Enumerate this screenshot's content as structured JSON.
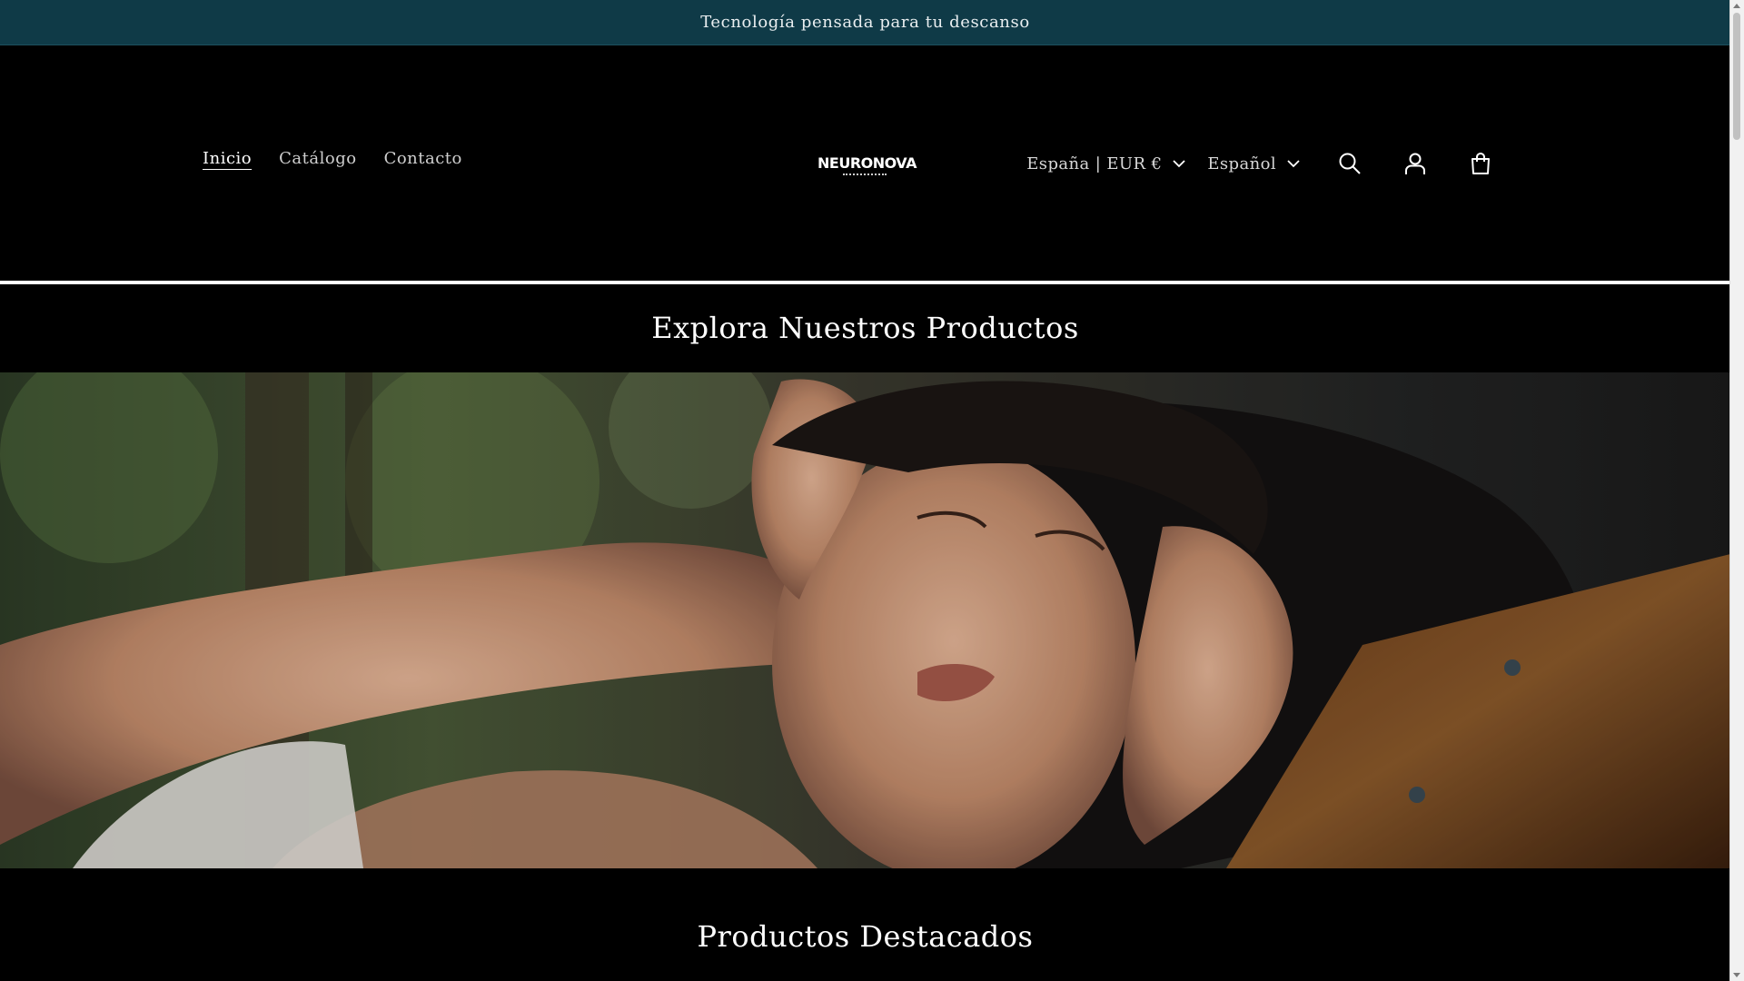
{
  "announcement": {
    "text": "Tecnología pensada para tu descanso"
  },
  "nav": {
    "items": [
      {
        "label": "Inicio",
        "active": true
      },
      {
        "label": "Catálogo",
        "active": false
      },
      {
        "label": "Contacto",
        "active": false
      }
    ]
  },
  "logo": {
    "text": "NEURONOVA",
    "icon": "horse-head-icon"
  },
  "header": {
    "country_selector": "España | EUR €",
    "language_selector": "Español",
    "icons": [
      "search-icon",
      "account-icon",
      "cart-icon"
    ]
  },
  "sections": {
    "explore_title": "Explora Nuestros Productos",
    "featured_title": "Productos Destacados"
  },
  "colors": {
    "announcement_bg": "#0f3a47",
    "page_bg": "#000000",
    "text": "#ffffff"
  }
}
